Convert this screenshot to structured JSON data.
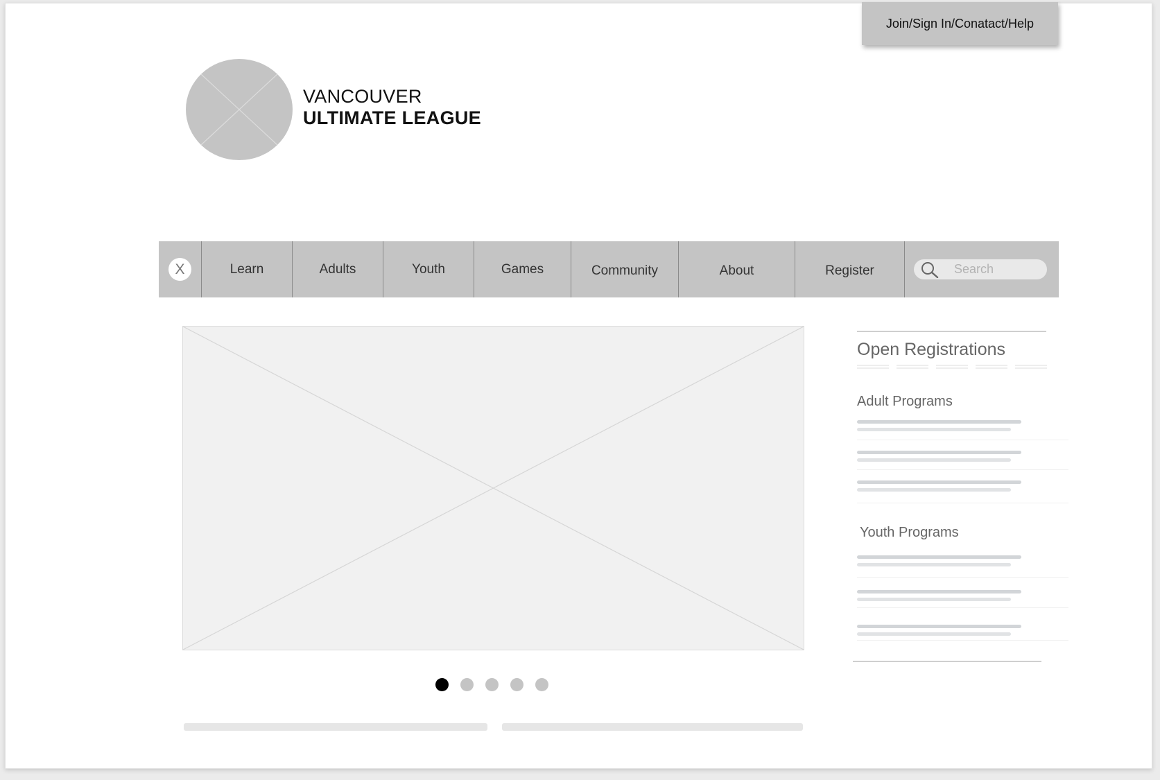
{
  "header": {
    "utility_link": "Join/Sign In/Conatact/Help",
    "brand_line1": "VANCOUVER",
    "brand_line2": "ULTIMATE LEAGUE"
  },
  "nav": {
    "close_label": "X",
    "items": [
      "Learn",
      "Adults",
      "Youth",
      "Games",
      "Community",
      "About",
      "Register"
    ],
    "search_placeholder": "Search"
  },
  "carousel": {
    "slide_count": 5,
    "active_index": 0
  },
  "sidebar": {
    "title": "Open Registrations",
    "sections": [
      {
        "label": "Adult Programs",
        "item_count": 3
      },
      {
        "label": "Youth Programs",
        "item_count": 3
      }
    ]
  },
  "colors": {
    "nav_background": "#c4c4c4",
    "placeholder_fill": "#f1f1f1",
    "active_dot": "#000000",
    "inactive_dot": "#c4c4c4"
  }
}
